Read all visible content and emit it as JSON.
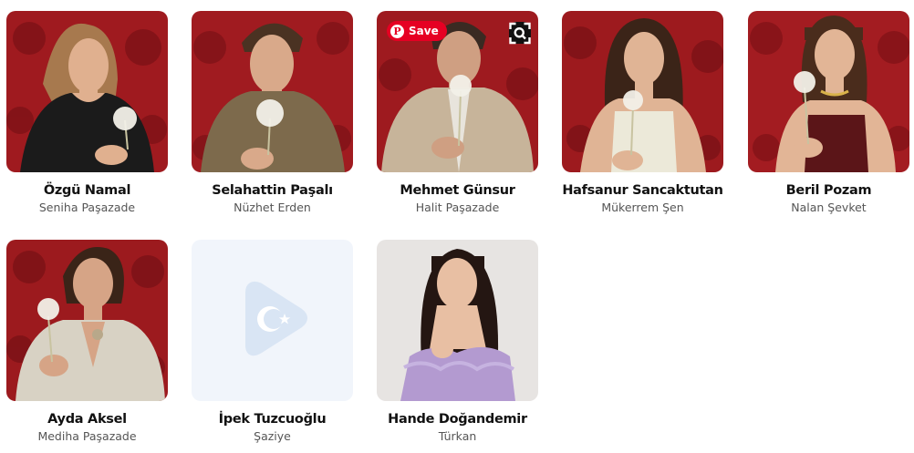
{
  "cast": [
    {
      "name": "Özgü Namal",
      "role": "Seniha Paşazade",
      "bg": "#9f1a1f",
      "outfit": "#1b1b1b",
      "skin": "#e0b08f",
      "hair": "#a7794e"
    },
    {
      "name": "Selahattin Paşalı",
      "role": "Nüzhet Erden",
      "bg": "#a01b20",
      "outfit": "#7d6a4c",
      "skin": "#d9a98a",
      "hair": "#4a3222"
    },
    {
      "name": "Mehmet Günsur",
      "role": "Halit Paşazade",
      "bg": "#9e1a1f",
      "outfit": "#c7b49a",
      "skin": "#cf9f82",
      "hair": "#3a2a22"
    },
    {
      "name": "Hafsanur Sancaktutan",
      "role": "Mükerrem Şen",
      "bg": "#9d1a1e",
      "outfit": "#ece9d9",
      "skin": "#e0b495",
      "hair": "#3b2418"
    },
    {
      "name": "Beril Pozam",
      "role": "Nalan Şevket",
      "bg": "#a31c21",
      "outfit": "#5b1518",
      "skin": "#e2b596",
      "hair": "#4a2c1c"
    },
    {
      "name": "Ayda Aksel",
      "role": "Mediha Paşazade",
      "bg": "#9c1a1e",
      "outfit": "#d8d2c4",
      "skin": "#d6a486",
      "hair": "#3a2418"
    },
    {
      "name": "İpek Tuzcuoğlu",
      "role": "Şaziye",
      "placeholder": true
    },
    {
      "name": "Hande Doğandemir",
      "role": "Türkan",
      "bg": "#e7e4e2",
      "outfit": "#b39ad0",
      "skin": "#e8bfa3",
      "hair": "#241612"
    }
  ],
  "overlay": {
    "save_label": "Save",
    "pin_glyph": "P"
  }
}
